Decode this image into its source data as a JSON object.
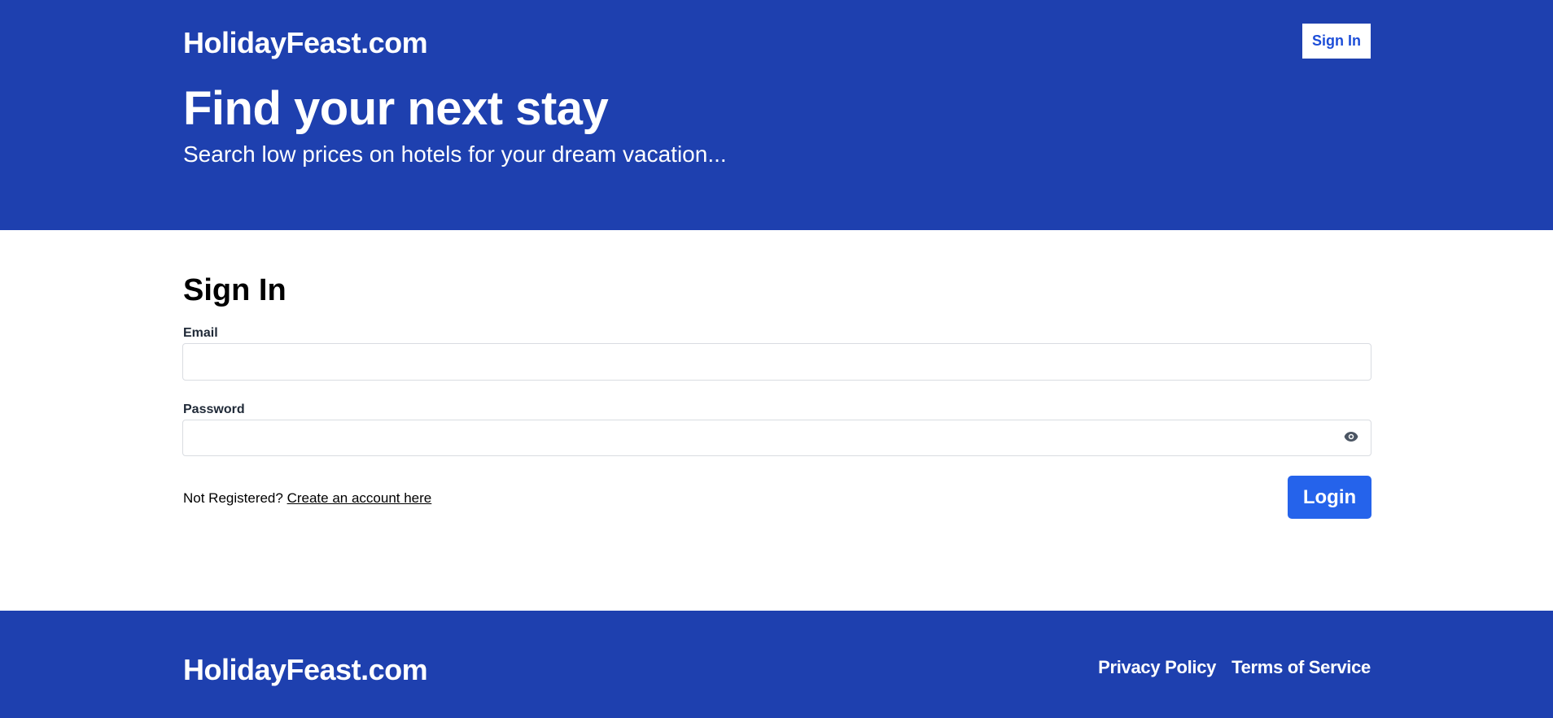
{
  "header": {
    "logo": "HolidayFeast.com",
    "signin_label": "Sign In",
    "hero_title": "Find your next stay",
    "hero_subtitle": "Search low prices on hotels for your dream vacation..."
  },
  "form": {
    "title": "Sign In",
    "email_label": "Email",
    "email_value": "",
    "password_label": "Password",
    "password_value": "",
    "password_toggle_icon": "eye-icon",
    "not_registered_text": "Not Registered?",
    "create_account_link": "Create an account here",
    "login_label": "Login"
  },
  "footer": {
    "logo": "HolidayFeast.com",
    "links": [
      "Privacy Policy",
      "Terms of Service"
    ]
  },
  "colors": {
    "brand_blue": "#1e40af",
    "button_blue": "#2563eb"
  }
}
